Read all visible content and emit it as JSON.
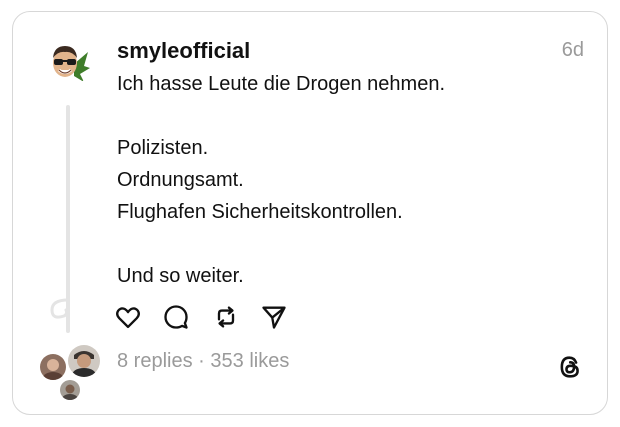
{
  "post": {
    "username": "smyleofficial",
    "timestamp": "6d",
    "lines": [
      "Ich hasse Leute die Drogen nehmen.",
      "",
      "Polizisten.",
      "Ordnungsamt.",
      "Flughafen Sicherheitskontrollen.",
      "",
      "Und so weiter."
    ]
  },
  "actions": {
    "icons": [
      "heart-icon",
      "comment-icon",
      "repost-icon",
      "share-icon"
    ]
  },
  "stats": {
    "replies": "8 replies",
    "separator": "·",
    "likes": "353 likes"
  },
  "colors": {
    "text": "#111111",
    "muted": "#9a9a9a",
    "border": "#d7d7d7",
    "thread_line": "#e4e4e4"
  }
}
